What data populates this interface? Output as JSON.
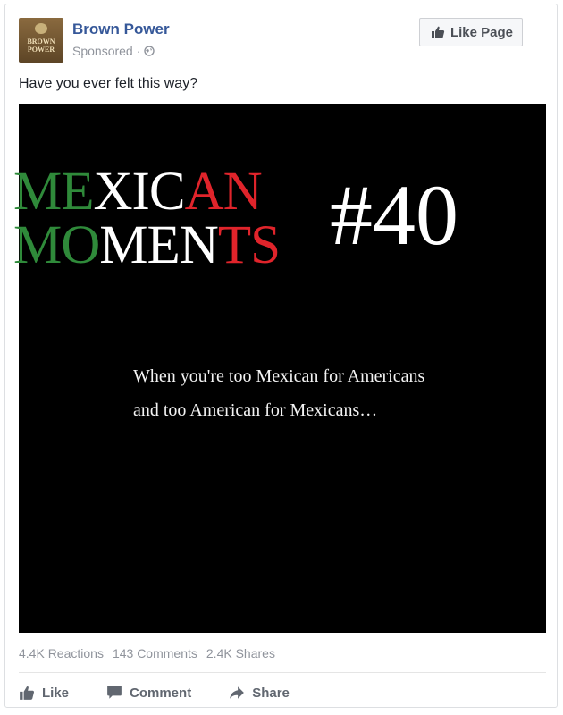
{
  "post": {
    "page_name": "Brown Power",
    "sponsored_label": "Sponsored",
    "separator": "·",
    "like_page_label": "Like Page",
    "text": "Have you ever felt this way?"
  },
  "avatar": {
    "logo_text_line1": "BROWN",
    "logo_text_line2": "POWER"
  },
  "image": {
    "title_line1": [
      "ME",
      "XIC",
      "AN"
    ],
    "title_line2": [
      "MO",
      "MEN",
      "TS"
    ],
    "number": "#40",
    "caption_line1": "When you're too Mexican for Americans",
    "caption_line2": "and too American for Mexicans…",
    "colors": {
      "green": "#2f8a3a",
      "white": "#ffffff",
      "red": "#e0242b"
    }
  },
  "stats": {
    "reactions": "4.4K Reactions",
    "comments": "143 Comments",
    "shares": "2.4K Shares"
  },
  "actions": {
    "like": "Like",
    "comment": "Comment",
    "share": "Share"
  },
  "icons": [
    "globe-icon",
    "thumbs-up-icon",
    "comment-icon",
    "share-icon"
  ]
}
